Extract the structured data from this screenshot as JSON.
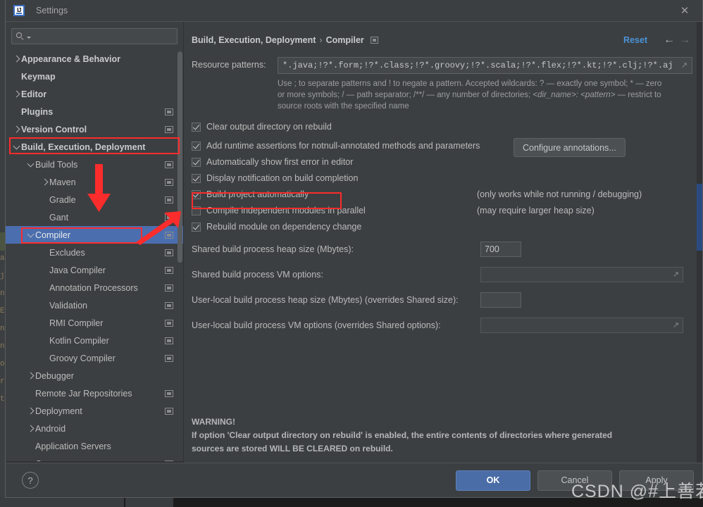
{
  "window": {
    "title": "Settings",
    "app_icon": "intellij-idea-icon",
    "close_icon": "close-icon"
  },
  "search": {
    "value": "",
    "placeholder": "",
    "icon": "search-icon"
  },
  "sidebar": {
    "items": [
      {
        "label": "Appearance & Behavior",
        "indent": 0,
        "arrow": "right",
        "bold": true,
        "badge": false,
        "selected": false
      },
      {
        "label": "Keymap",
        "indent": 0,
        "arrow": "none",
        "bold": true,
        "badge": false,
        "selected": false
      },
      {
        "label": "Editor",
        "indent": 0,
        "arrow": "right",
        "bold": true,
        "badge": false,
        "selected": false
      },
      {
        "label": "Plugins",
        "indent": 0,
        "arrow": "none",
        "bold": true,
        "badge": true,
        "selected": false
      },
      {
        "label": "Version Control",
        "indent": 0,
        "arrow": "right",
        "bold": true,
        "badge": true,
        "selected": false
      },
      {
        "label": "Build, Execution, Deployment",
        "indent": 0,
        "arrow": "down",
        "bold": true,
        "badge": false,
        "selected": false
      },
      {
        "label": "Build Tools",
        "indent": 1,
        "arrow": "down",
        "bold": false,
        "badge": true,
        "selected": false
      },
      {
        "label": "Maven",
        "indent": 2,
        "arrow": "right",
        "bold": false,
        "badge": true,
        "selected": false
      },
      {
        "label": "Gradle",
        "indent": 2,
        "arrow": "none",
        "bold": false,
        "badge": true,
        "selected": false
      },
      {
        "label": "Gant",
        "indent": 2,
        "arrow": "none",
        "bold": false,
        "badge": true,
        "selected": false
      },
      {
        "label": "Compiler",
        "indent": 1,
        "arrow": "down",
        "bold": false,
        "badge": true,
        "selected": true
      },
      {
        "label": "Excludes",
        "indent": 2,
        "arrow": "none",
        "bold": false,
        "badge": true,
        "selected": false
      },
      {
        "label": "Java Compiler",
        "indent": 2,
        "arrow": "none",
        "bold": false,
        "badge": true,
        "selected": false
      },
      {
        "label": "Annotation Processors",
        "indent": 2,
        "arrow": "none",
        "bold": false,
        "badge": true,
        "selected": false
      },
      {
        "label": "Validation",
        "indent": 2,
        "arrow": "none",
        "bold": false,
        "badge": true,
        "selected": false
      },
      {
        "label": "RMI Compiler",
        "indent": 2,
        "arrow": "none",
        "bold": false,
        "badge": true,
        "selected": false
      },
      {
        "label": "Kotlin Compiler",
        "indent": 2,
        "arrow": "none",
        "bold": false,
        "badge": true,
        "selected": false
      },
      {
        "label": "Groovy Compiler",
        "indent": 2,
        "arrow": "none",
        "bold": false,
        "badge": true,
        "selected": false
      },
      {
        "label": "Debugger",
        "indent": 1,
        "arrow": "right",
        "bold": false,
        "badge": false,
        "selected": false
      },
      {
        "label": "Remote Jar Repositories",
        "indent": 1,
        "arrow": "none",
        "bold": false,
        "badge": true,
        "selected": false
      },
      {
        "label": "Deployment",
        "indent": 1,
        "arrow": "right",
        "bold": false,
        "badge": true,
        "selected": false
      },
      {
        "label": "Android",
        "indent": 1,
        "arrow": "right",
        "bold": false,
        "badge": false,
        "selected": false
      },
      {
        "label": "Application Servers",
        "indent": 1,
        "arrow": "none",
        "bold": false,
        "badge": false,
        "selected": false
      },
      {
        "label": "Coverage",
        "indent": 1,
        "arrow": "none",
        "bold": false,
        "badge": true,
        "selected": false
      }
    ]
  },
  "breadcrumb": {
    "root": "Build, Execution, Deployment",
    "separator": "›",
    "leaf": "Compiler",
    "badge_icon": "project-scope-icon"
  },
  "header_actions": {
    "reset_label": "Reset",
    "back_icon": "arrow-left-icon",
    "forward_icon": "arrow-right-icon"
  },
  "main": {
    "resource_patterns": {
      "label": "Resource patterns:",
      "value": "*.java;!?*.form;!?*.class;!?*.groovy;!?*.scala;!?*.flex;!?*.kt;!?*.clj;!?*.aj",
      "expand_icon": "expand-field-icon",
      "hint_line1": "Use ; to separate patterns and ! to negate a pattern. Accepted wildcards: ? — exactly one symbol; * — zero",
      "hint_line2a": "or more symbols; / — path separator; /**/ — any number of directories;  ",
      "hint_line2b": "<dir_name>: <pattern>",
      "hint_line2c": " — restrict to",
      "hint_line3": "source roots with the specified name"
    },
    "checkboxes": [
      {
        "label": "Clear output directory on rebuild",
        "checked": true,
        "note": ""
      },
      {
        "label": "Add runtime assertions for notnull-annotated methods and parameters",
        "checked": true,
        "note": ""
      },
      {
        "label": "Automatically show first error in editor",
        "checked": true,
        "note": ""
      },
      {
        "label": "Display notification on build completion",
        "checked": true,
        "note": ""
      },
      {
        "label": "Build project automatically",
        "checked": true,
        "note": "(only works while not running / debugging)"
      },
      {
        "label": "Compile independent modules in parallel",
        "checked": false,
        "note": "(may require larger heap size)"
      },
      {
        "label": "Rebuild module on dependency change",
        "checked": true,
        "note": ""
      }
    ],
    "configure_annotations_button": "Configure annotations...",
    "fields": [
      {
        "label": "Shared build process heap size (Mbytes):",
        "value": "700",
        "kind": "small"
      },
      {
        "label": "Shared build process VM options:",
        "value": "",
        "kind": "large"
      },
      {
        "label": "User-local build process heap size (Mbytes) (overrides Shared size):",
        "value": "",
        "kind": "small"
      },
      {
        "label": "User-local build process VM options (overrides Shared options):",
        "value": "",
        "kind": "large"
      }
    ],
    "warning": {
      "title": "WARNING!",
      "line1": "If option 'Clear output directory on rebuild' is enabled, the entire contents of directories where generated",
      "line2": "sources are stored WILL BE CLEARED on rebuild."
    }
  },
  "footer": {
    "help_label": "?",
    "ok_label": "OK",
    "cancel_label": "Cancel",
    "apply_label": "Apply"
  },
  "watermark": {
    "text": "CSDN @#上善若水"
  },
  "background": {
    "editor_fragments": [
      "ar",
      "jit",
      "na",
      "E",
      "nv",
      "nv",
      "o",
      "rn",
      "to"
    ]
  },
  "colors": {
    "dialog_bg": "#3c3f41",
    "selection_blue": "#4b6eaf",
    "accent_link": "#4a93d8",
    "annotation_red": "#fb2c2c",
    "primary_button": "#4a6da7",
    "scroll_blue": "#2b4a80"
  }
}
